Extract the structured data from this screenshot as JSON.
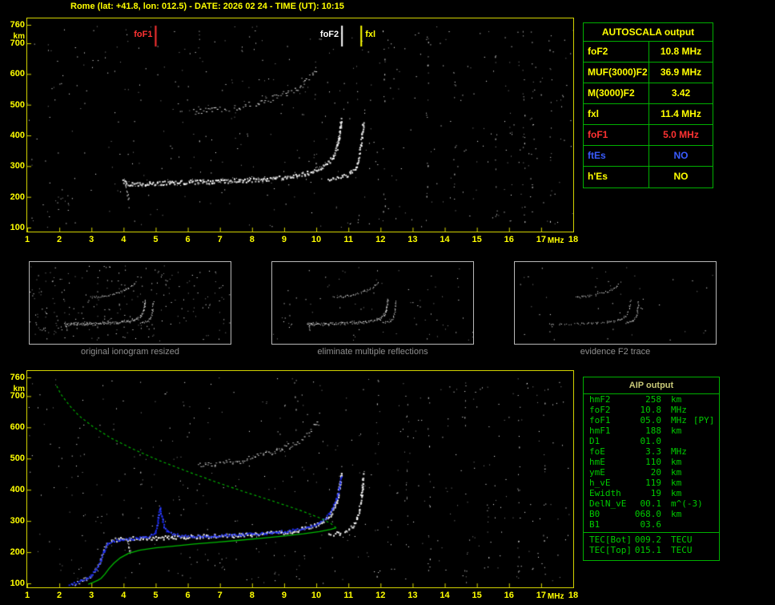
{
  "title": "Rome (lat: +41.8, lon: 012.5) - DATE: 2026 02 24 - TIME (UT): 10:15",
  "colors": {
    "background": "#000000",
    "axis_yellow": "#ffff00",
    "border_yellow": "#d2d200",
    "table_green": "#00b000",
    "trace_white": "#ffffff",
    "fitted_blue": "#2334ff",
    "profile_green": "#00bb00",
    "alert_red": "#ff3232",
    "info_blue": "#3a5cff",
    "caption_gray": "#8f8f8f"
  },
  "autoscala": {
    "header": "AUTOSCALA output",
    "rows": [
      {
        "label": "foF2",
        "value": "10.8 MHz",
        "color": "#ffff00"
      },
      {
        "label": "MUF(3000)F2",
        "value": "36.9 MHz",
        "color": "#ffff00"
      },
      {
        "label": "M(3000)F2",
        "value": "3.42",
        "color": "#ffff00"
      },
      {
        "label": "fxl",
        "value": "11.4 MHz",
        "color": "#ffff00"
      },
      {
        "label": "foF1",
        "value": "5.0 MHz",
        "color": "#ff3232"
      },
      {
        "label": "ftEs",
        "value": "NO",
        "color": "#3a5cff"
      },
      {
        "label": "h'Es",
        "value": "NO",
        "color": "#ffff00"
      }
    ]
  },
  "aip": {
    "header": "AIP output",
    "rows": [
      {
        "name": "hmF2",
        "value": "258",
        "unit": "km",
        "extra": ""
      },
      {
        "name": "foF2",
        "value": "10.8",
        "unit": "MHz",
        "extra": ""
      },
      {
        "name": "foF1",
        "value": "05.0",
        "unit": "MHz",
        "extra": "[PY]"
      },
      {
        "name": "hmF1",
        "value": "188",
        "unit": "km",
        "extra": ""
      },
      {
        "name": "D1",
        "value": "01.0",
        "unit": "",
        "extra": ""
      },
      {
        "name": "foE",
        "value": "3.3",
        "unit": "MHz",
        "extra": ""
      },
      {
        "name": "hmE",
        "value": "110",
        "unit": "km",
        "extra": ""
      },
      {
        "name": "ymE",
        "value": "20",
        "unit": "km",
        "extra": ""
      },
      {
        "name": "h_vE",
        "value": "119",
        "unit": "km",
        "extra": ""
      },
      {
        "name": "Ewidth",
        "value": "19",
        "unit": "km",
        "extra": ""
      },
      {
        "name": "DelN_vE",
        "value": "00.1",
        "unit": "m^(-3)",
        "extra": ""
      },
      {
        "name": "B0",
        "value": "068.0",
        "unit": "km",
        "extra": ""
      },
      {
        "name": "B1",
        "value": "03.6",
        "unit": "",
        "extra": ""
      }
    ],
    "tec_rows": [
      {
        "name": "TEC[Bot]",
        "value": "009.2",
        "unit": "TECU",
        "extra": ""
      },
      {
        "name": "TEC[Top]",
        "value": "015.1",
        "unit": "TECU",
        "extra": ""
      }
    ]
  },
  "thumbnails": [
    {
      "caption": "original ionogram resized"
    },
    {
      "caption": "eliminate multiple reflections"
    },
    {
      "caption": "evidence F2 trace"
    }
  ],
  "chart_data": [
    {
      "type": "scatter",
      "name": "ionogram-autoscaled",
      "title": "",
      "xlabel": "MHz",
      "ylabel": "km",
      "xlim": [
        1,
        18
      ],
      "ylim": [
        100,
        760
      ],
      "x_ticks": [
        1,
        2,
        3,
        4,
        5,
        6,
        7,
        8,
        9,
        10,
        11,
        12,
        13,
        14,
        15,
        16,
        17,
        18
      ],
      "y_ticks": [
        760,
        700,
        600,
        500,
        400,
        300,
        200,
        100
      ],
      "markers": [
        {
          "label": "foF1",
          "f": 5.0,
          "color": "#ff3232",
          "side": "left"
        },
        {
          "label": "foF2",
          "f": 10.8,
          "color": "#ffffff",
          "side": "left"
        },
        {
          "label": "fxl",
          "f": 11.4,
          "color": "#ffff00",
          "side": "right"
        }
      ],
      "traces": {
        "f2_ordinary": [
          [
            3.95,
            252
          ],
          [
            4.2,
            243
          ],
          [
            4.6,
            244
          ],
          [
            5.2,
            247
          ],
          [
            6.0,
            250
          ],
          [
            6.8,
            252
          ],
          [
            7.6,
            255
          ],
          [
            8.4,
            259
          ],
          [
            9.0,
            265
          ],
          [
            9.4,
            271
          ],
          [
            9.8,
            281
          ],
          [
            10.1,
            294
          ],
          [
            10.35,
            312
          ],
          [
            10.5,
            332
          ],
          [
            10.62,
            362
          ],
          [
            10.7,
            400
          ],
          [
            10.74,
            432
          ],
          [
            10.77,
            455
          ]
        ],
        "f2_extraordinary": [
          [
            10.35,
            258
          ],
          [
            10.7,
            263
          ],
          [
            10.95,
            272
          ],
          [
            11.12,
            287
          ],
          [
            11.25,
            308
          ],
          [
            11.33,
            338
          ],
          [
            11.38,
            372
          ],
          [
            11.42,
            412
          ],
          [
            11.45,
            452
          ]
        ],
        "second_hop": [
          [
            6.15,
            476
          ],
          [
            6.7,
            481
          ],
          [
            7.2,
            488
          ],
          [
            7.7,
            497
          ],
          [
            8.2,
            509
          ],
          [
            8.7,
            524
          ],
          [
            9.1,
            541
          ],
          [
            9.45,
            560
          ],
          [
            9.7,
            580
          ],
          [
            9.9,
            602
          ],
          [
            10.02,
            618
          ]
        ],
        "f1_cusp": [
          [
            4.05,
            238
          ],
          [
            4.1,
            222
          ],
          [
            4.13,
            205
          ],
          [
            4.16,
            190
          ]
        ],
        "e_patch": [
          [
            1.9,
            195
          ],
          [
            2.05,
            200
          ],
          [
            2.2,
            207
          ],
          [
            2.35,
            213
          ]
        ]
      },
      "noise": {
        "count": 430,
        "stripes": [
          {
            "f": 6.35,
            "n": 8
          },
          {
            "f": 9.95,
            "n": 10
          },
          {
            "f": 12.1,
            "n": 12
          },
          {
            "f": 13.45,
            "n": 16
          },
          {
            "f": 14.3,
            "n": 10
          },
          {
            "f": 15.6,
            "n": 12
          },
          {
            "f": 16.45,
            "n": 18
          },
          {
            "f": 16.7,
            "n": 10
          },
          {
            "f": 17.3,
            "n": 14
          }
        ]
      }
    },
    {
      "type": "scatter",
      "name": "ionogram-with-density-profile",
      "title": "",
      "xlabel": "MHz",
      "ylabel": "km",
      "xlim": [
        1,
        18
      ],
      "ylim": [
        100,
        760
      ],
      "x_ticks": [
        1,
        2,
        3,
        4,
        5,
        6,
        7,
        8,
        9,
        10,
        11,
        12,
        13,
        14,
        15,
        16,
        17,
        18
      ],
      "y_ticks": [
        760,
        700,
        600,
        500,
        400,
        300,
        200,
        100
      ],
      "traces": {
        "f2_ordinary": [
          [
            3.6,
            240
          ],
          [
            3.9,
            243
          ],
          [
            4.3,
            245
          ],
          [
            4.8,
            247
          ],
          [
            5.4,
            249
          ],
          [
            6.0,
            251
          ],
          [
            6.8,
            253
          ],
          [
            7.6,
            256
          ],
          [
            8.4,
            260
          ],
          [
            9.0,
            266
          ],
          [
            9.4,
            272
          ],
          [
            9.8,
            282
          ],
          [
            10.1,
            295
          ],
          [
            10.35,
            313
          ],
          [
            10.5,
            333
          ],
          [
            10.62,
            363
          ],
          [
            10.7,
            400
          ],
          [
            10.74,
            433
          ],
          [
            10.77,
            456
          ]
        ],
        "f2_extraordinary": [
          [
            10.35,
            258
          ],
          [
            10.7,
            263
          ],
          [
            10.95,
            272
          ],
          [
            11.12,
            287
          ],
          [
            11.25,
            308
          ],
          [
            11.33,
            338
          ],
          [
            11.38,
            372
          ],
          [
            11.42,
            412
          ],
          [
            11.45,
            452
          ]
        ],
        "second_hop": [
          [
            6.3,
            478
          ],
          [
            6.8,
            483
          ],
          [
            7.3,
            490
          ],
          [
            7.8,
            499
          ],
          [
            8.3,
            511
          ],
          [
            8.8,
            527
          ],
          [
            9.2,
            544
          ],
          [
            9.5,
            562
          ],
          [
            9.75,
            583
          ],
          [
            9.95,
            605
          ],
          [
            10.05,
            620
          ]
        ],
        "f1_cusp": [
          [
            4.1,
            240
          ],
          [
            4.15,
            225
          ],
          [
            4.18,
            210
          ],
          [
            4.2,
            196
          ]
        ],
        "el_riser": [
          [
            2.45,
            100
          ],
          [
            2.65,
            107
          ],
          [
            2.85,
            116
          ],
          [
            3.0,
            128
          ],
          [
            3.1,
            143
          ],
          [
            3.2,
            162
          ],
          [
            3.3,
            188
          ],
          [
            3.4,
            218
          ],
          [
            3.5,
            236
          ]
        ]
      },
      "fitted_trace": [
        [
          2.3,
          97
        ],
        [
          2.55,
          105
        ],
        [
          2.8,
          115
        ],
        [
          2.95,
          126
        ],
        [
          3.08,
          140
        ],
        [
          3.2,
          158
        ],
        [
          3.3,
          182
        ],
        [
          3.38,
          208
        ],
        [
          3.5,
          228
        ],
        [
          3.7,
          238
        ],
        [
          4.0,
          243
        ],
        [
          4.4,
          247
        ],
        [
          4.75,
          252
        ],
        [
          4.95,
          262
        ],
        [
          5.02,
          285
        ],
        [
          5.07,
          315
        ],
        [
          5.12,
          345
        ],
        [
          5.18,
          310
        ],
        [
          5.25,
          282
        ],
        [
          5.4,
          264
        ],
        [
          5.7,
          255
        ],
        [
          6.2,
          252
        ],
        [
          6.8,
          254
        ],
        [
          7.4,
          257
        ],
        [
          8.0,
          260
        ],
        [
          8.6,
          264
        ],
        [
          9.1,
          270
        ],
        [
          9.5,
          277
        ],
        [
          9.85,
          287
        ],
        [
          10.1,
          298
        ],
        [
          10.3,
          314
        ],
        [
          10.45,
          334
        ],
        [
          10.58,
          362
        ],
        [
          10.68,
          398
        ],
        [
          10.74,
          430
        ],
        [
          10.78,
          452
        ]
      ],
      "density_profile": {
        "bottomside": [
          [
            2.9,
            97
          ],
          [
            3.05,
            103
          ],
          [
            3.2,
            110
          ],
          [
            3.3,
            116
          ],
          [
            3.42,
            130
          ],
          [
            3.55,
            148
          ],
          [
            3.7,
            165
          ],
          [
            3.9,
            182
          ],
          [
            4.15,
            196
          ],
          [
            4.5,
            206
          ],
          [
            5.0,
            214
          ],
          [
            5.6,
            220
          ],
          [
            6.2,
            226
          ],
          [
            6.9,
            232
          ],
          [
            7.6,
            238
          ],
          [
            8.3,
            245
          ],
          [
            9.0,
            252
          ],
          [
            9.6,
            259
          ],
          [
            10.1,
            266
          ],
          [
            10.45,
            273
          ],
          [
            10.62,
            278
          ]
        ],
        "topside": [
          [
            10.62,
            278
          ],
          [
            10.45,
            292
          ],
          [
            10.1,
            310
          ],
          [
            9.5,
            334
          ],
          [
            8.7,
            362
          ],
          [
            7.8,
            392
          ],
          [
            6.9,
            424
          ],
          [
            6.0,
            458
          ],
          [
            5.1,
            494
          ],
          [
            4.3,
            530
          ],
          [
            3.6,
            566
          ],
          [
            3.05,
            602
          ],
          [
            2.6,
            638
          ],
          [
            2.3,
            672
          ],
          [
            2.05,
            706
          ],
          [
            1.9,
            736
          ]
        ]
      },
      "noise": {
        "count": 430,
        "stripes": [
          {
            "f": 4.55,
            "n": 8
          },
          {
            "f": 9.35,
            "n": 10
          },
          {
            "f": 11.9,
            "n": 10
          },
          {
            "f": 12.8,
            "n": 10
          },
          {
            "f": 13.5,
            "n": 14
          },
          {
            "f": 14.65,
            "n": 10
          },
          {
            "f": 15.35,
            "n": 10
          },
          {
            "f": 16.3,
            "n": 14
          },
          {
            "f": 17.1,
            "n": 12
          }
        ]
      }
    }
  ]
}
